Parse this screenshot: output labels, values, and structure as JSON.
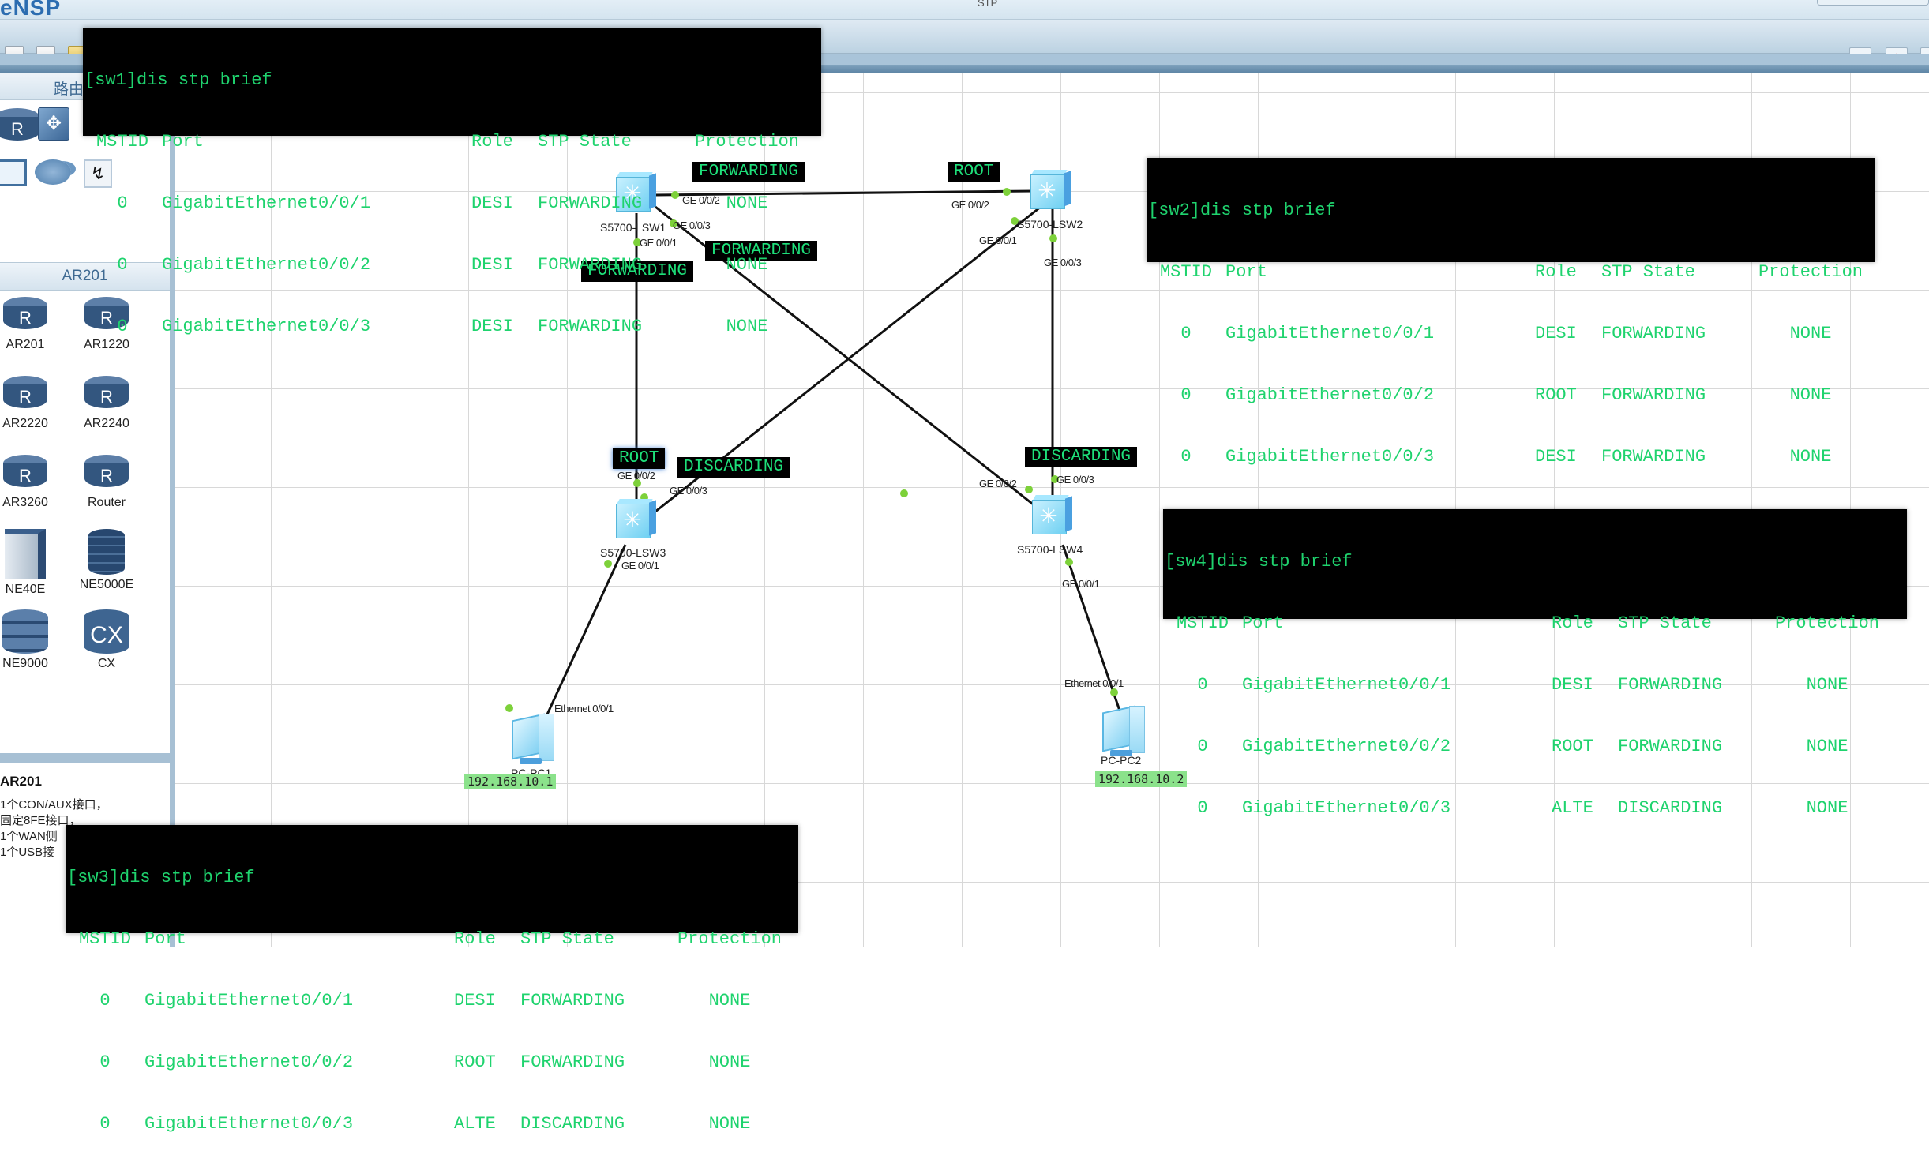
{
  "app": {
    "logo": "eNSP",
    "window_title": "STP"
  },
  "toolbar": {
    "right_icons": [
      "chat-icon",
      "huawei-logo-icon"
    ]
  },
  "sidebar": {
    "header": "路由",
    "top_icons": [
      "router-icon",
      "switch-icon",
      "pc-icon",
      "cloud-icon",
      "power-link-icon"
    ],
    "section_title": "AR201",
    "devices": [
      {
        "label": "AR201",
        "icon": "router-icon"
      },
      {
        "label": "AR1220",
        "icon": "router-icon"
      },
      {
        "label": "AR2220",
        "icon": "router-icon"
      },
      {
        "label": "AR2240",
        "icon": "router-icon"
      },
      {
        "label": "AR3260",
        "icon": "router-icon"
      },
      {
        "label": "Router",
        "icon": "router-icon"
      },
      {
        "label": "NE40E",
        "icon": "chassis-icon"
      },
      {
        "label": "NE5000E",
        "icon": "core-router-icon"
      },
      {
        "label": "NE9000",
        "icon": "stacked-router-icon"
      },
      {
        "label": "CX",
        "icon": "cx-router-icon"
      }
    ],
    "info": {
      "title": "AR201",
      "description": "1个CON/AUX接口，\n固定8FE接口，\n1个WAN侧\n1个USB接"
    }
  },
  "topology": {
    "devices": [
      {
        "name": "S5700-LSW1",
        "type": "switch"
      },
      {
        "name": "S5700-LSW2",
        "type": "switch"
      },
      {
        "name": "S5700-LSW3",
        "type": "switch"
      },
      {
        "name": "S5700-LSW4",
        "type": "switch"
      },
      {
        "name": "PC-PC1",
        "type": "pc",
        "ip": "192.168.10.1"
      },
      {
        "name": "PC-PC2",
        "type": "pc",
        "ip": "192.168.10.2"
      }
    ],
    "ports": {
      "lsw1_g2": "GE 0/0/2",
      "lsw1_g3": "GE 0/0/3",
      "lsw1_g1": "GE 0/0/1",
      "lsw2_g2": "GE 0/0/2",
      "lsw2_g1": "GE 0/0/1",
      "lsw2_g3": "GE 0/0/3",
      "lsw3_g2": "GE 0/0/2",
      "lsw3_g3": "GE 0/0/3",
      "lsw3_g1": "GE 0/0/1",
      "lsw4_g2": "GE 0/0/2",
      "lsw4_g3": "GE 0/0/3",
      "lsw4_g1": "GE 0/0/1",
      "pc1_e1": "Ethernet 0/0/1",
      "pc2_e1": "Ethernet 0/0/1"
    },
    "annotations": {
      "lsw1_g2_state": "FORWARDING",
      "lsw2_g2_role": "ROOT",
      "lsw1_g3_state": "FORWARDING",
      "lsw1_g1_state": "FORWARDING",
      "lsw3_g2_role": "ROOT",
      "lsw3_g3_state": "DISCARDING",
      "lsw4_g3_state": "DISCARDING"
    }
  },
  "terminals": [
    {
      "id": "sw1",
      "command": "[sw1]dis stp brief",
      "headers": [
        "MSTID",
        "Port",
        "Role",
        "STP State",
        "Protection"
      ],
      "rows": [
        [
          "0",
          "GigabitEthernet0/0/1",
          "DESI",
          "FORWARDING",
          "NONE"
        ],
        [
          "0",
          "GigabitEthernet0/0/2",
          "DESI",
          "FORWARDING",
          "NONE"
        ],
        [
          "0",
          "GigabitEthernet0/0/3",
          "DESI",
          "FORWARDING",
          "NONE"
        ]
      ]
    },
    {
      "id": "sw2",
      "command": "[sw2]dis stp brief",
      "headers": [
        "MSTID",
        "Port",
        "Role",
        "STP State",
        "Protection"
      ],
      "rows": [
        [
          "0",
          "GigabitEthernet0/0/1",
          "DESI",
          "FORWARDING",
          "NONE"
        ],
        [
          "0",
          "GigabitEthernet0/0/2",
          "ROOT",
          "FORWARDING",
          "NONE"
        ],
        [
          "0",
          "GigabitEthernet0/0/3",
          "DESI",
          "FORWARDING",
          "NONE"
        ]
      ]
    },
    {
      "id": "sw4",
      "command": "[sw4]dis stp brief",
      "headers": [
        "MSTID",
        "Port",
        "Role",
        "STP State",
        "Protection"
      ],
      "rows": [
        [
          "0",
          "GigabitEthernet0/0/1",
          "DESI",
          "FORWARDING",
          "NONE"
        ],
        [
          "0",
          "GigabitEthernet0/0/2",
          "ROOT",
          "FORWARDING",
          "NONE"
        ],
        [
          "0",
          "GigabitEthernet0/0/3",
          "ALTE",
          "DISCARDING",
          "NONE"
        ]
      ]
    },
    {
      "id": "sw3",
      "command": "[sw3]dis stp brief",
      "headers": [
        "MSTID",
        "Port",
        "Role",
        "STP State",
        "Protection"
      ],
      "rows": [
        [
          "0",
          "GigabitEthernet0/0/1",
          "DESI",
          "FORWARDING",
          "NONE"
        ],
        [
          "0",
          "GigabitEthernet0/0/2",
          "ROOT",
          "FORWARDING",
          "NONE"
        ],
        [
          "0",
          "GigabitEthernet0/0/3",
          "ALTE",
          "DISCARDING",
          "NONE"
        ]
      ]
    }
  ]
}
